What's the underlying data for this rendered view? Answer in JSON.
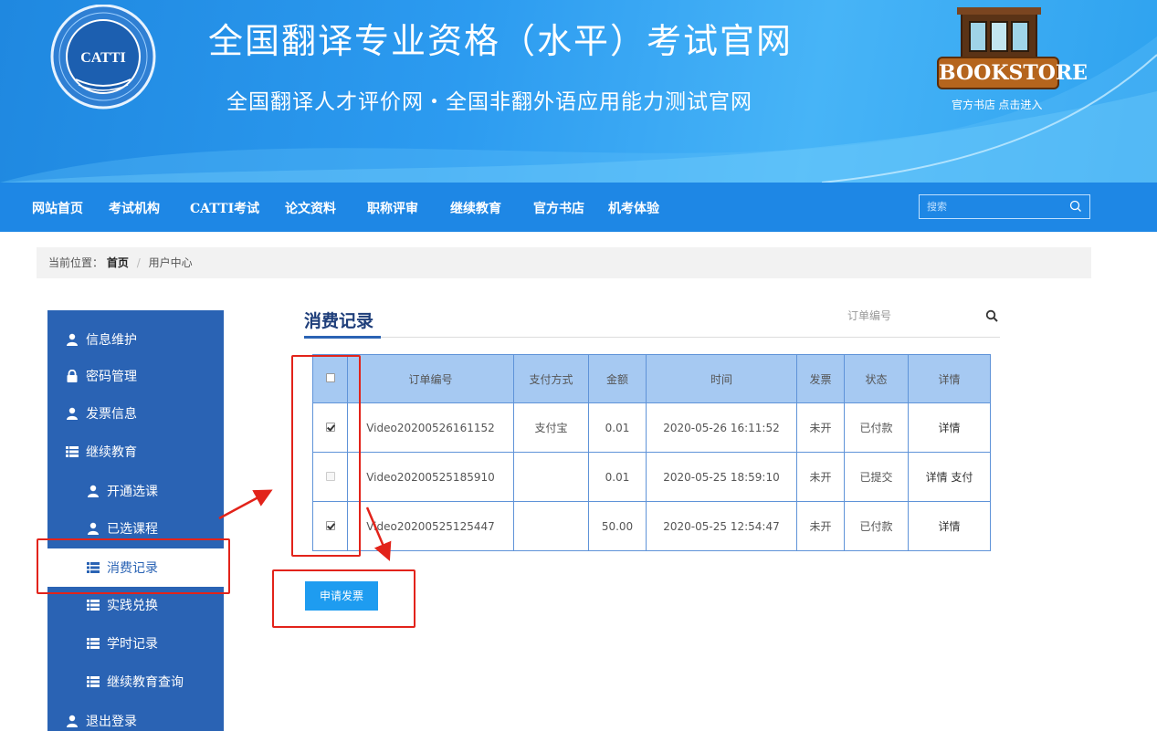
{
  "header": {
    "logo_text": "CATTI",
    "title": "全国翻译专业资格（水平）考试官网",
    "subtitle": "全国翻译人才评价网・全国非翻外语应用能力测试官网",
    "bookstore_sign": "BOOKSTORE",
    "bookstore_caption": "官方书店 点击进入"
  },
  "nav": {
    "items": [
      "网站首页",
      "考试机构",
      "CATTI考试",
      "论文资料",
      "职称评审",
      "继续教育",
      "官方书店",
      "机考体验"
    ],
    "search_placeholder": "搜索",
    "search_icon": "search-icon"
  },
  "breadcrumb": {
    "prefix": "当前位置：",
    "home": "首页",
    "separator": "/",
    "current": "用户中心"
  },
  "sidebar": {
    "active_index": 6,
    "items": [
      {
        "label": "信息维护",
        "icon": "user-icon",
        "level": 0
      },
      {
        "label": "密码管理",
        "icon": "lock-icon",
        "level": 0
      },
      {
        "label": "发票信息",
        "icon": "user-icon",
        "level": 0
      },
      {
        "label": "继续教育",
        "icon": "list-icon",
        "level": 0
      },
      {
        "label": "开通选课",
        "icon": "user-icon",
        "level": 1
      },
      {
        "label": "已选课程",
        "icon": "user-icon",
        "level": 1
      },
      {
        "label": "消费记录",
        "icon": "list-icon",
        "level": 1
      },
      {
        "label": "实践兑换",
        "icon": "list-icon",
        "level": 1
      },
      {
        "label": "学时记录",
        "icon": "list-icon",
        "level": 1
      },
      {
        "label": "继续教育查询",
        "icon": "list-icon",
        "level": 1
      },
      {
        "label": "退出登录",
        "icon": "user-icon",
        "level": 0
      }
    ]
  },
  "main": {
    "title": "消费记录",
    "order_search_placeholder": "订单编号",
    "table": {
      "headers": [
        "",
        "订单编号",
        "支付方式",
        "金额",
        "时间",
        "发票",
        "状态",
        "详情"
      ],
      "rows": [
        {
          "checked": true,
          "order_no": "Video20200526161152",
          "pay_method": "支付宝",
          "amount": "0.01",
          "time": "2020-05-26 16:11:52",
          "invoice": "未开",
          "status": "已付款",
          "detail": "详情",
          "pay_link": ""
        },
        {
          "checked": false,
          "disabled": true,
          "order_no": "Video20200525185910",
          "pay_method": "",
          "amount": "0.01",
          "time": "2020-05-25 18:59:10",
          "invoice": "未开",
          "status": "已提交",
          "detail": "详情",
          "pay_link": "支付"
        },
        {
          "checked": true,
          "order_no": "Video20200525125447",
          "pay_method": "",
          "amount": "50.00",
          "time": "2020-05-25 12:54:47",
          "invoice": "未开",
          "status": "已付款",
          "detail": "详情",
          "pay_link": ""
        }
      ]
    },
    "apply_button": "申请发票"
  },
  "colors": {
    "header_blue": "#2c9bf0",
    "nav_blue": "#1e87e5",
    "sidebar_blue": "#2a63b4",
    "table_header": "#a6c9f2",
    "table_border": "#5f93d8",
    "button_blue": "#1e9cf0",
    "annotation_red": "#e2231a"
  }
}
